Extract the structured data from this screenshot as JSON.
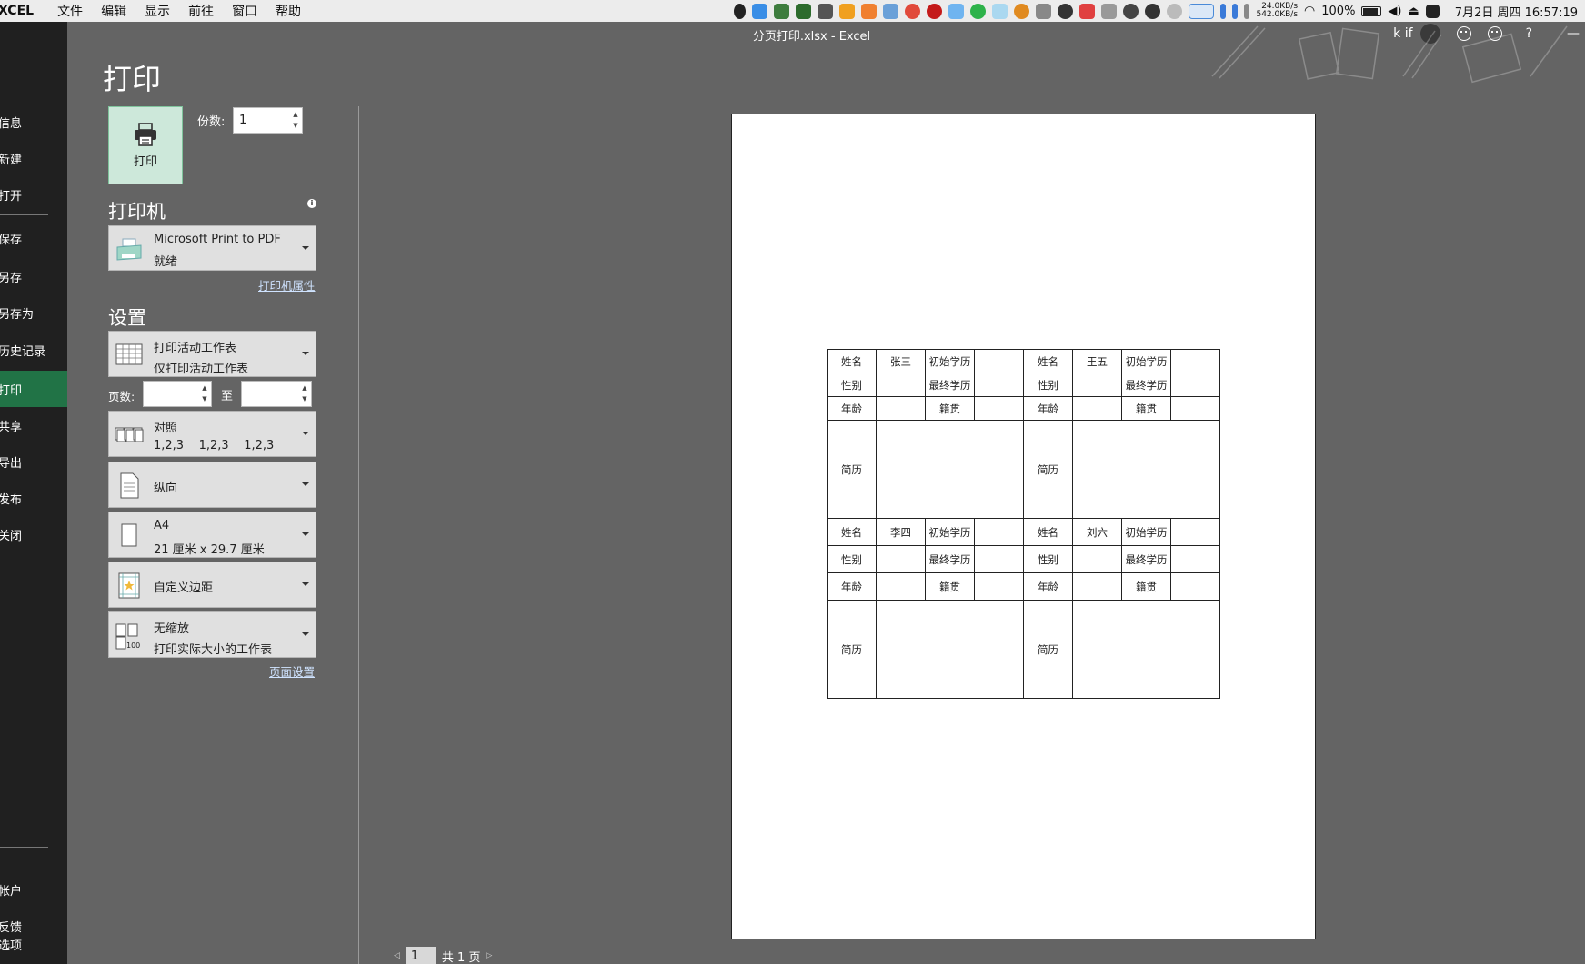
{
  "menubar": {
    "app": "XCEL",
    "menus": [
      "文件",
      "编辑",
      "显示",
      "前往",
      "窗口",
      "帮助"
    ],
    "net_up": "24.0KB/s",
    "net_down": "542.0KB/s",
    "battery": "100%",
    "clock": "7月2日 周四 16:57:19"
  },
  "titlebar": {
    "title": "分页打印.xlsx  -  Excel",
    "user": "k if",
    "help": "?"
  },
  "nav": {
    "items": [
      "信息",
      "新建",
      "打开",
      "保存",
      "另存",
      "另存为",
      "历史记录",
      "打印",
      "共享",
      "导出",
      "发布",
      "关闭",
      "帐户",
      "反馈",
      "选项"
    ]
  },
  "print": {
    "title": "打印",
    "button_label": "打印",
    "copies_label": "份数:",
    "copies_value": "1"
  },
  "printer": {
    "section": "打印机",
    "info": "i",
    "name": "Microsoft Print to PDF",
    "status": "就绪",
    "properties_link": "打印机属性"
  },
  "settings": {
    "section": "设置",
    "what": {
      "line1": "打印活动工作表",
      "line2": "仅打印活动工作表"
    },
    "pages_label": "页数:",
    "pages_from": "",
    "to_label": "至",
    "pages_to": "",
    "collate": {
      "line1": "对照",
      "line2": "1,2,3    1,2,3    1,2,3"
    },
    "orientation": "纵向",
    "paper": {
      "line1": "A4",
      "line2": "21 厘米 x 29.7 厘米"
    },
    "margins": "自定义边距",
    "scaling": {
      "line1": "无缩放",
      "line2": "打印实际大小的工作表"
    },
    "page_setup_link": "页面设置"
  },
  "preview": {
    "rows": [
      [
        "姓名",
        "张三",
        "初始学历",
        "",
        "姓名",
        "王五",
        "初始学历",
        ""
      ],
      [
        "性别",
        "",
        "最终学历",
        "",
        "性别",
        "",
        "最终学历",
        ""
      ],
      [
        "年龄",
        "",
        "籍贯",
        "",
        "年龄",
        "",
        "籍贯",
        ""
      ],
      [
        "简历",
        "简历"
      ],
      [
        "姓名",
        "李四",
        "初始学历",
        "",
        "姓名",
        "刘六",
        "初始学历",
        ""
      ],
      [
        "性别",
        "",
        "最终学历",
        "",
        "性别",
        "",
        "最终学历",
        ""
      ],
      [
        "年龄",
        "",
        "籍贯",
        "",
        "年龄",
        "",
        "籍贯",
        ""
      ],
      [
        "简历",
        "简历"
      ]
    ]
  },
  "page_nav": {
    "current": "1",
    "total": "共 1 页"
  }
}
